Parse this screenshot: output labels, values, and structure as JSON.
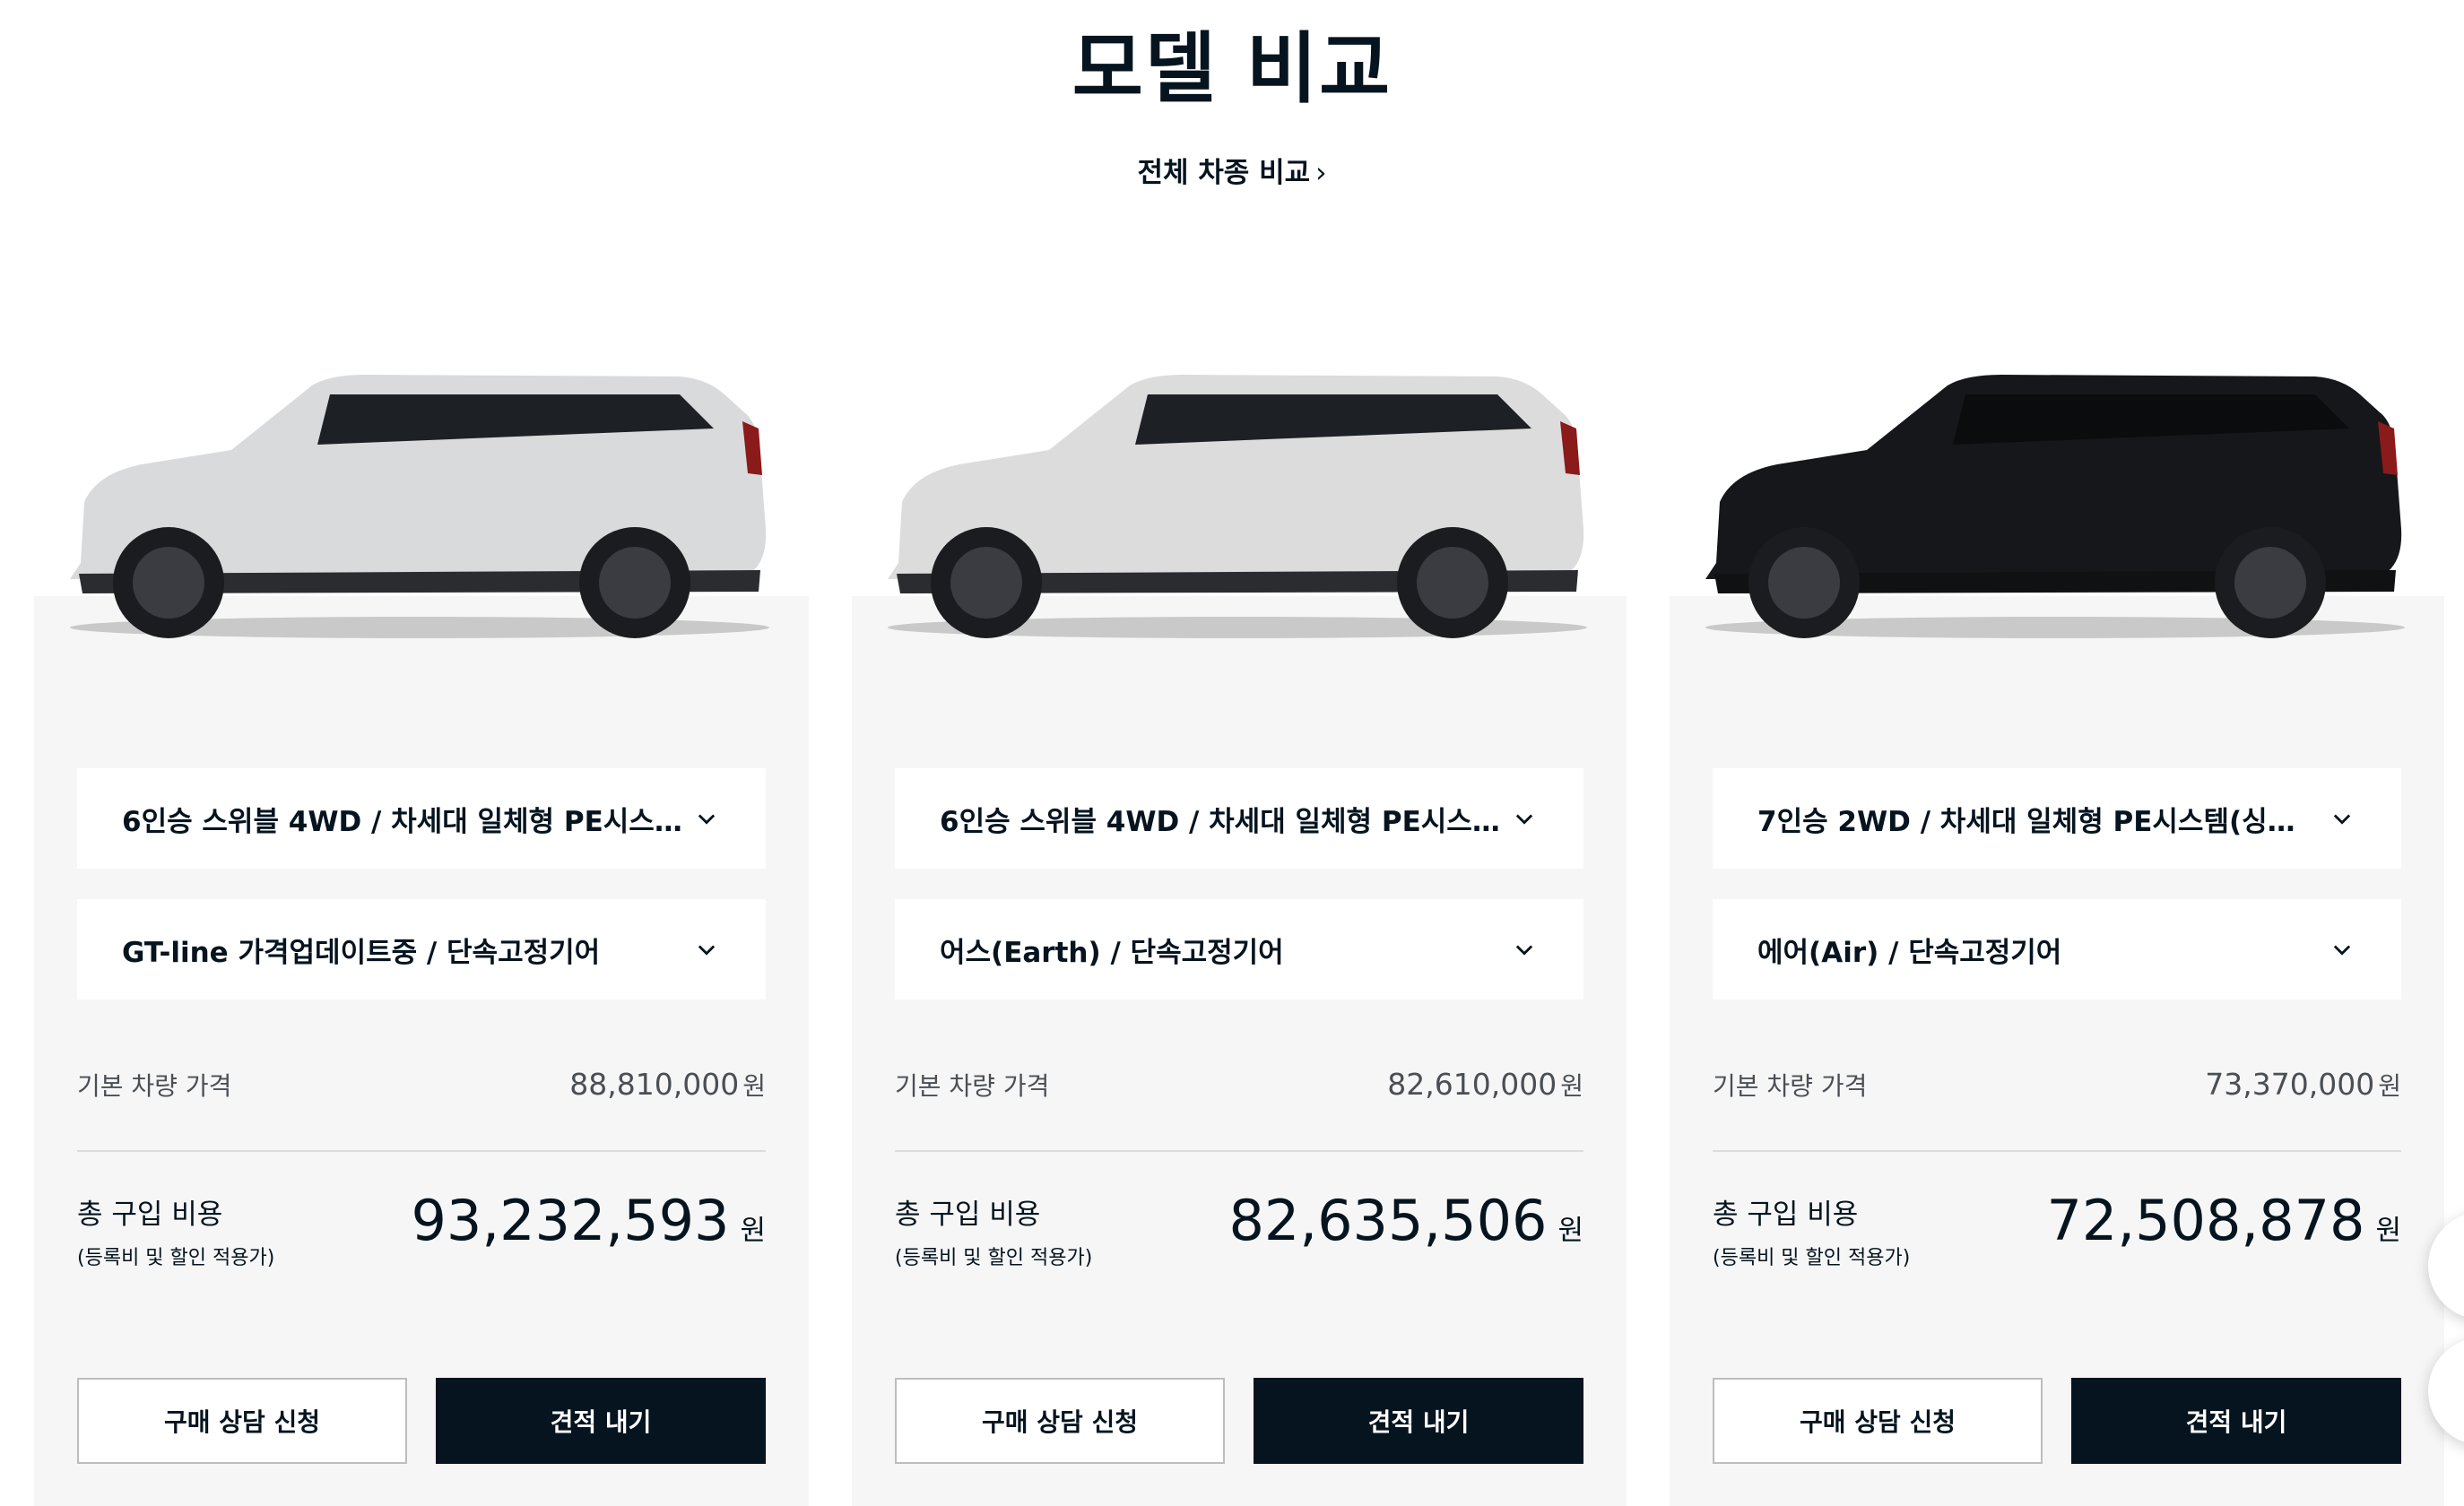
{
  "header": {
    "title": "모델 비교",
    "compare_all_link": "전체 차종 비교",
    "compare_all_chevron": "›"
  },
  "cards": [
    {
      "car_color": "#d9dadb",
      "trim_select": "6인승 스위블 4WD / 차세대 일체형 PE시스...",
      "grade_select": "GT-line 가격업데이트중 / 단속고정기어",
      "base_price_label": "기본 차량 가격",
      "base_price": "88,810,000",
      "base_price_unit": "원",
      "total_label": "총 구입 비용",
      "total_sub": "(등록비 및 할인 적용가)",
      "total_price": "93,232,593",
      "total_unit": "원",
      "consult_button": "구매 상담 신청",
      "quote_button": "견적 내기"
    },
    {
      "car_color": "#dcdcdc",
      "trim_select": "6인승 스위블 4WD / 차세대 일체형 PE시스...",
      "grade_select": "어스(Earth) / 단속고정기어",
      "base_price_label": "기본 차량 가격",
      "base_price": "82,610,000",
      "base_price_unit": "원",
      "total_label": "총 구입 비용",
      "total_sub": "(등록비 및 할인 적용가)",
      "total_price": "82,635,506",
      "total_unit": "원",
      "consult_button": "구매 상담 신청",
      "quote_button": "견적 내기"
    },
    {
      "car_color": "#15171b",
      "trim_select": "7인승 2WD / 차세대 일체형 PE시스템(싱글...",
      "grade_select": "에어(Air) / 단속고정기어",
      "base_price_label": "기본 차량 가격",
      "base_price": "73,370,000",
      "base_price_unit": "원",
      "total_label": "총 구입 비용",
      "total_sub": "(등록비 및 할인 적용가)",
      "total_price": "72,508,878",
      "total_unit": "원",
      "consult_button": "구매 상담 신청",
      "quote_button": "견적 내기"
    }
  ],
  "icons": {
    "dropdown": "chevron-down-icon",
    "link": "chevron-right-icon"
  },
  "colors": {
    "primary": "#05141f",
    "card_bg": "#f6f6f6",
    "muted_text": "#4a4f55"
  }
}
